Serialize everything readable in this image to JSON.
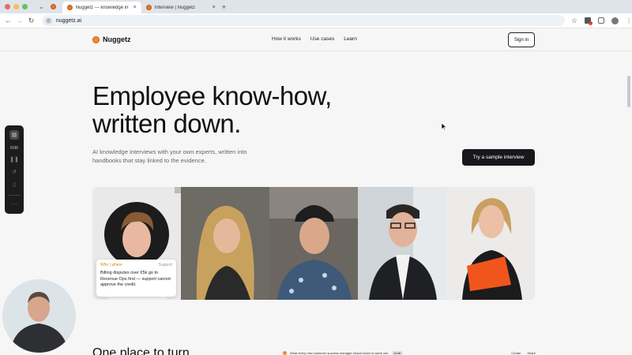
{
  "browser": {
    "tabs": [
      {
        "label": "Nuggetz — knowledge in",
        "active": true,
        "close": "×"
      },
      {
        "label": "Interview | Nuggetz",
        "active": false,
        "close": "×"
      }
    ],
    "new_tab": "+",
    "url": "nuggetz.ai",
    "colors": {
      "chrome": "#dfe3ea",
      "favicon": "#e8732a"
    }
  },
  "nav": {
    "brand": "Nuggetz",
    "links": [
      "How it works",
      "Use cases",
      "Learn"
    ],
    "signin": "Sign in"
  },
  "hero": {
    "title_line1": "Employee know-how,",
    "title_line2": "written down.",
    "subtitle": "AI knowledge interviews with your own experts, written into handbooks that stay linked to the evidence.",
    "cta": "Try a sample interview"
  },
  "card": {
    "label": "Who | where",
    "tag": "Support",
    "body": "Billing disputes over €5k go to Revenue Ops first — support cannot approve the credit."
  },
  "section": {
    "title": "One place to turn"
  },
  "preview": {
    "text": "What every new customer success manager should know in week one",
    "pill": "Draft",
    "actions": [
      "Create",
      "Share"
    ]
  },
  "recorder": {
    "time": "0:00",
    "icons": [
      "stop-icon",
      "pause-icon",
      "restart-icon",
      "delete-icon",
      "menu-icon"
    ]
  }
}
